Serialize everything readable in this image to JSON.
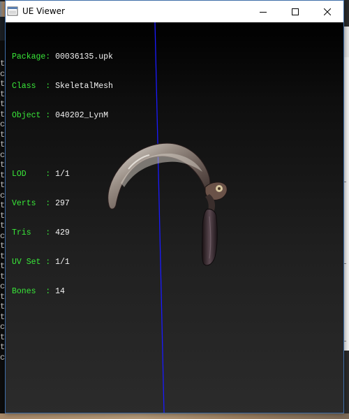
{
  "window": {
    "title": "UE Viewer",
    "controls": {
      "minimize": "minimize-icon",
      "maximize": "maximize-icon",
      "close": "close-icon"
    }
  },
  "info": {
    "package": {
      "label": "Package: ",
      "value": "00036135.upk"
    },
    "class": {
      "label": "Class  : ",
      "value": "SkeletalMesh"
    },
    "object": {
      "label": "Object : ",
      "value": "040202_LynM"
    },
    "lod": {
      "label": "LOD    : ",
      "value": "1/1"
    },
    "verts": {
      "label": "Verts  : ",
      "value": "297"
    },
    "tris": {
      "label": "Tris   : ",
      "value": "429"
    },
    "uvset": {
      "label": "UV Set : ",
      "value": "1/1"
    },
    "bones": {
      "label": "Bones  : ",
      "value": "14"
    }
  },
  "background": {
    "console_glyphs": "t\nc\nt\nt\nt\nt\nc\nt\nt\nc\nt\nt\nt\nc\nt\nt\nt\nc\nt\nt\nt\nt\nc\nt\nt\nt\nc\nt\nt\nc"
  },
  "colors": {
    "label": "#39e839",
    "value": "#f2f2f2",
    "axis": "#1a1aff",
    "viewport_top": "#000000",
    "viewport_bottom": "#2b2b2b"
  }
}
